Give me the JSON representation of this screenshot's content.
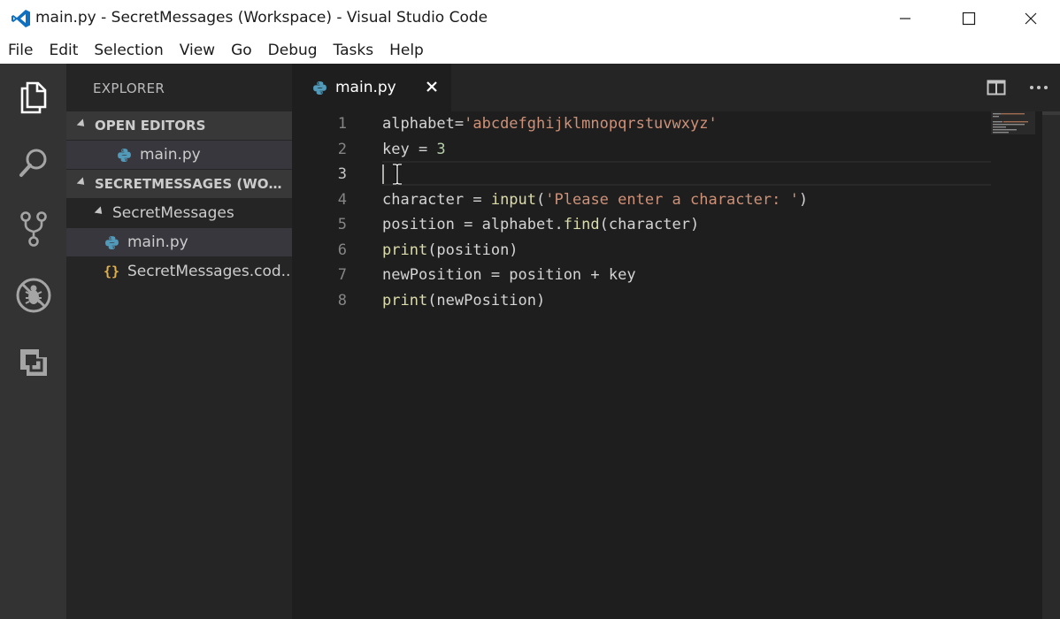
{
  "window": {
    "title": "main.py - SecretMessages (Workspace) - Visual Studio Code"
  },
  "menu": [
    "File",
    "Edit",
    "Selection",
    "View",
    "Go",
    "Debug",
    "Tasks",
    "Help"
  ],
  "sidebar": {
    "title": "EXPLORER",
    "open_editors_header": "OPEN EDITORS",
    "open_editors": [
      {
        "label": "main.py",
        "icon": "python-icon"
      }
    ],
    "workspace_header": "SECRETMESSAGES (WORKS...",
    "folder": "SecretMessages",
    "files": [
      {
        "label": "main.py",
        "icon": "python-icon"
      },
      {
        "label": "SecretMessages.cod...",
        "icon": "json-braces-icon"
      }
    ]
  },
  "tab": {
    "label": "main.py",
    "icon": "python-icon"
  },
  "code": {
    "line_numbers": [
      "1",
      "2",
      "3",
      "4",
      "5",
      "6",
      "7",
      "8"
    ],
    "lines": {
      "l1_a": "alphabet=",
      "l1_b": "'abcdefghijklmnopqrstuvwxyz'",
      "l2_a": "key = ",
      "l2_b": "3",
      "l4_a": "character = ",
      "l4_b": "input",
      "l4_c": "(",
      "l4_d": "'Please enter a character: '",
      "l4_e": ")",
      "l5_a": "position = alphabet.",
      "l5_b": "find",
      "l5_c": "(character)",
      "l6_a": "print",
      "l6_b": "(position)",
      "l7_a": "newPosition = position + key",
      "l8_a": "print",
      "l8_b": "(newPosition)"
    }
  },
  "colors": {
    "accent": "#007acc",
    "python_blue": "#519aba",
    "json_yellow": "#e2b14c",
    "string": "#ce9178",
    "number": "#b5cea8",
    "function": "#dcdcaa"
  }
}
